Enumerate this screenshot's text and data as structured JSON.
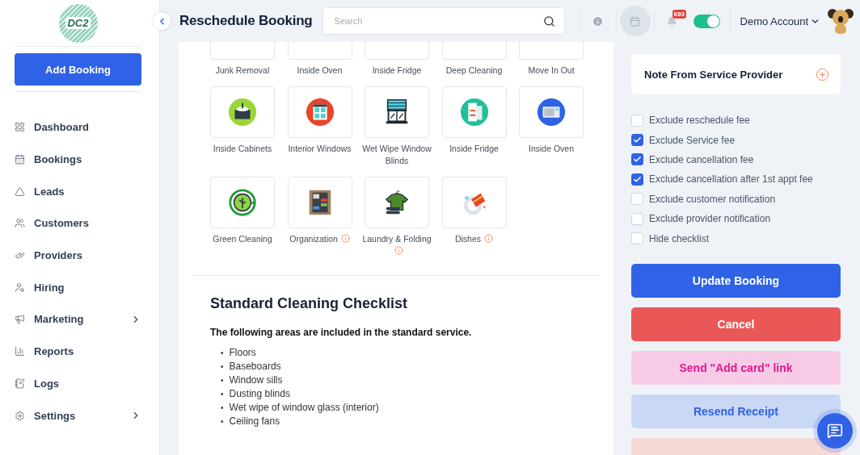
{
  "sidebar": {
    "logo_text": "DC2",
    "add_button": "Add Booking",
    "items": [
      {
        "label": "Dashboard",
        "has_submenu": false
      },
      {
        "label": "Bookings",
        "has_submenu": false
      },
      {
        "label": "Leads",
        "has_submenu": false
      },
      {
        "label": "Customers",
        "has_submenu": false
      },
      {
        "label": "Providers",
        "has_submenu": false
      },
      {
        "label": "Hiring",
        "has_submenu": false
      },
      {
        "label": "Marketing",
        "has_submenu": true
      },
      {
        "label": "Reports",
        "has_submenu": false
      },
      {
        "label": "Logs",
        "has_submenu": false
      },
      {
        "label": "Settings",
        "has_submenu": true
      }
    ]
  },
  "header": {
    "title": "Reschedule Booking",
    "search": {
      "placeholder": "Search"
    },
    "notification_count": "693",
    "toggle": {
      "on": true
    },
    "account": "Demo Account"
  },
  "service_rows": [
    [
      {
        "label": "Junk Removal",
        "kind": "cut-off",
        "info": false
      },
      {
        "label": "Inside Oven",
        "kind": "cut-off",
        "info": false
      },
      {
        "label": "Inside Fridge",
        "kind": "cut-off",
        "info": false
      },
      {
        "label": "Deep Cleaning",
        "kind": "cut-off",
        "info": false
      },
      {
        "label": "Move In Out",
        "kind": "cut-off",
        "info": false
      }
    ],
    [
      {
        "label": "Inside Cabinets",
        "kind": "cabinet",
        "info": false
      },
      {
        "label": "Interior Windows",
        "kind": "window",
        "info": false
      },
      {
        "label": "Wet Wipe Window Blinds",
        "kind": "blinds",
        "info": false
      },
      {
        "label": "Inside Fridge",
        "kind": "fridge",
        "info": false
      },
      {
        "label": "Inside Oven",
        "kind": "oven",
        "info": false
      }
    ],
    [
      {
        "label": "Green Cleaning",
        "kind": "leaf",
        "info": false
      },
      {
        "label": "Organization",
        "kind": "wardrobe",
        "info": true
      },
      {
        "label": "Laundry & Folding",
        "kind": "shirt",
        "info": true
      },
      {
        "label": "Dishes",
        "kind": "dishes",
        "info": true
      }
    ]
  ],
  "checklist": {
    "title": "Standard Cleaning Checklist",
    "intro": "The following areas are included in the standard service.",
    "bullet": "•",
    "items": [
      "Floors",
      "Baseboards",
      "Window sills",
      "Dusting blinds",
      "Wet wipe of window glass (interior)",
      "Ceiling fans"
    ]
  },
  "note_card": {
    "title": "Note From Service Provider"
  },
  "options": [
    {
      "label": "Exclude reschedule fee",
      "checked": false
    },
    {
      "label": "Exclude Service fee",
      "checked": true
    },
    {
      "label": "Exclude cancellation fee",
      "checked": true
    },
    {
      "label": "Exclude cancellation after 1st appt fee",
      "checked": true
    },
    {
      "label": "Exclude customer notification",
      "checked": false
    },
    {
      "label": "Exclude provider notification",
      "checked": false
    },
    {
      "label": "Hide checklist",
      "checked": false
    }
  ],
  "actions": [
    {
      "label": "Update Booking",
      "kind": "primary"
    },
    {
      "label": "Cancel",
      "kind": "danger"
    },
    {
      "label": "Send \"Add card\" link",
      "kind": "pink"
    },
    {
      "label": "Resend Receipt",
      "kind": "light"
    },
    {
      "kind": "peach"
    }
  ]
}
